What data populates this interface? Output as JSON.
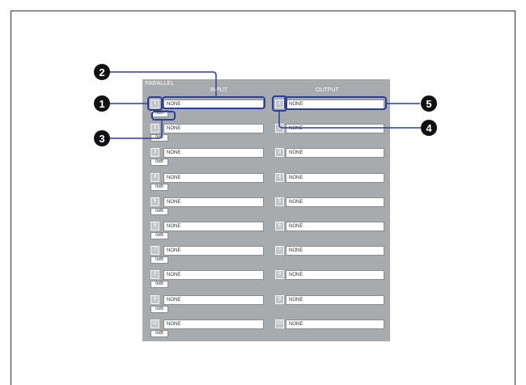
{
  "panel": {
    "title": "PARALLEL",
    "input_header": "INPUT",
    "output_header": "OUTPUT"
  },
  "inputs": [
    {
      "number": "1",
      "name": "NONE",
      "gain": "0dB"
    },
    {
      "number": "2",
      "name": "NONE",
      "gain": "0dB"
    },
    {
      "number": "3",
      "name": "NONE",
      "gain": "0dB"
    },
    {
      "number": "4",
      "name": "NONE",
      "gain": "0dB"
    },
    {
      "number": "5",
      "name": "NONE",
      "gain": "0dB"
    },
    {
      "number": "6",
      "name": "NONE",
      "gain": "0dB"
    },
    {
      "number": "7",
      "name": "NONE",
      "gain": "0dB"
    },
    {
      "number": "8",
      "name": "NONE",
      "gain": "0dB"
    },
    {
      "number": "9",
      "name": "NONE",
      "gain": "0dB"
    },
    {
      "number": "10",
      "name": "NONE",
      "gain": "0dB"
    }
  ],
  "outputs": [
    {
      "number": "1",
      "name": "NONE"
    },
    {
      "number": "2",
      "name": "NONE"
    },
    {
      "number": "3",
      "name": "NONE"
    },
    {
      "number": "4",
      "name": "NONE"
    },
    {
      "number": "5",
      "name": "NONE"
    },
    {
      "number": "6",
      "name": "NONE"
    },
    {
      "number": "7",
      "name": "NONE"
    },
    {
      "number": "8",
      "name": "NONE"
    },
    {
      "number": "9",
      "name": "NONE"
    },
    {
      "number": "10",
      "name": "NONE"
    }
  ],
  "callouts": [
    "1",
    "2",
    "3",
    "4",
    "5"
  ],
  "colors": {
    "panel_bg": "#a7abad",
    "callout_line": "#2a3f9a",
    "marker_fill": "#111111"
  }
}
